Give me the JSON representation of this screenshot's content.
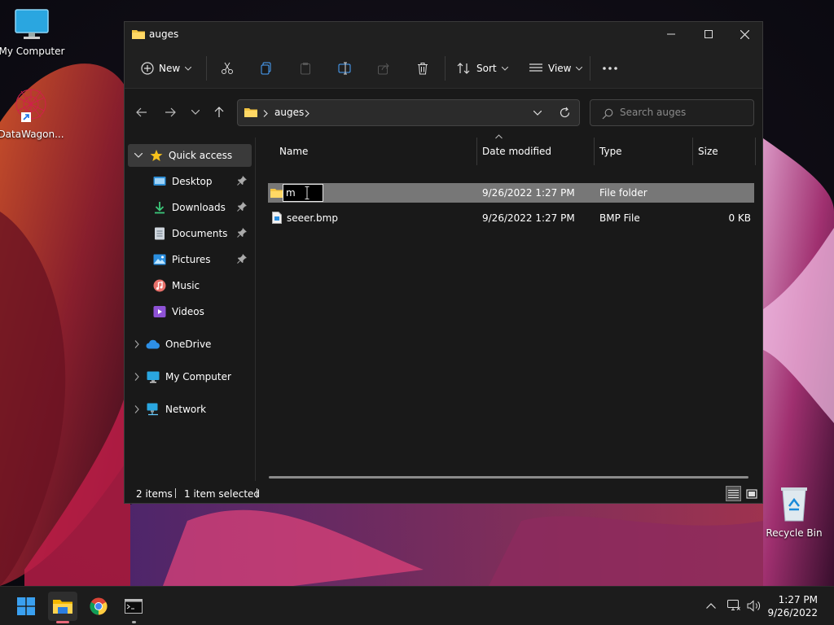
{
  "desktop": {
    "icons": [
      {
        "label": "My Computer"
      },
      {
        "label": "DataWagon..."
      },
      {
        "label": "Recycle Bin"
      }
    ]
  },
  "window": {
    "title": "auges",
    "toolbar": {
      "new_label": "New",
      "sort_label": "Sort",
      "view_label": "View"
    },
    "address": {
      "crumb": "auges"
    },
    "search": {
      "placeholder": "Search auges"
    },
    "nav": {
      "quick_access": "Quick access",
      "items": [
        {
          "label": "Desktop",
          "pinned": true
        },
        {
          "label": "Downloads",
          "pinned": true
        },
        {
          "label": "Documents",
          "pinned": true
        },
        {
          "label": "Pictures",
          "pinned": true
        },
        {
          "label": "Music",
          "pinned": false
        },
        {
          "label": "Videos",
          "pinned": false
        }
      ],
      "onedrive": "OneDrive",
      "my_computer": "My Computer",
      "network": "Network"
    },
    "columns": {
      "name": "Name",
      "date": "Date modified",
      "type": "Type",
      "size": "Size"
    },
    "files": [
      {
        "name": "m",
        "date": "9/26/2022 1:27 PM",
        "type": "File folder",
        "size": "",
        "renaming": true
      },
      {
        "name": "seeer.bmp",
        "date": "9/26/2022 1:27 PM",
        "type": "BMP File",
        "size": "0 KB"
      }
    ],
    "status": {
      "count": "2 items",
      "selected": "1 item selected"
    }
  },
  "taskbar": {
    "time": "1:27 PM",
    "date": "9/26/2022"
  },
  "colors": {
    "accent": "#0078d4",
    "folder": "#f4c542",
    "selected_row": "#777777"
  }
}
